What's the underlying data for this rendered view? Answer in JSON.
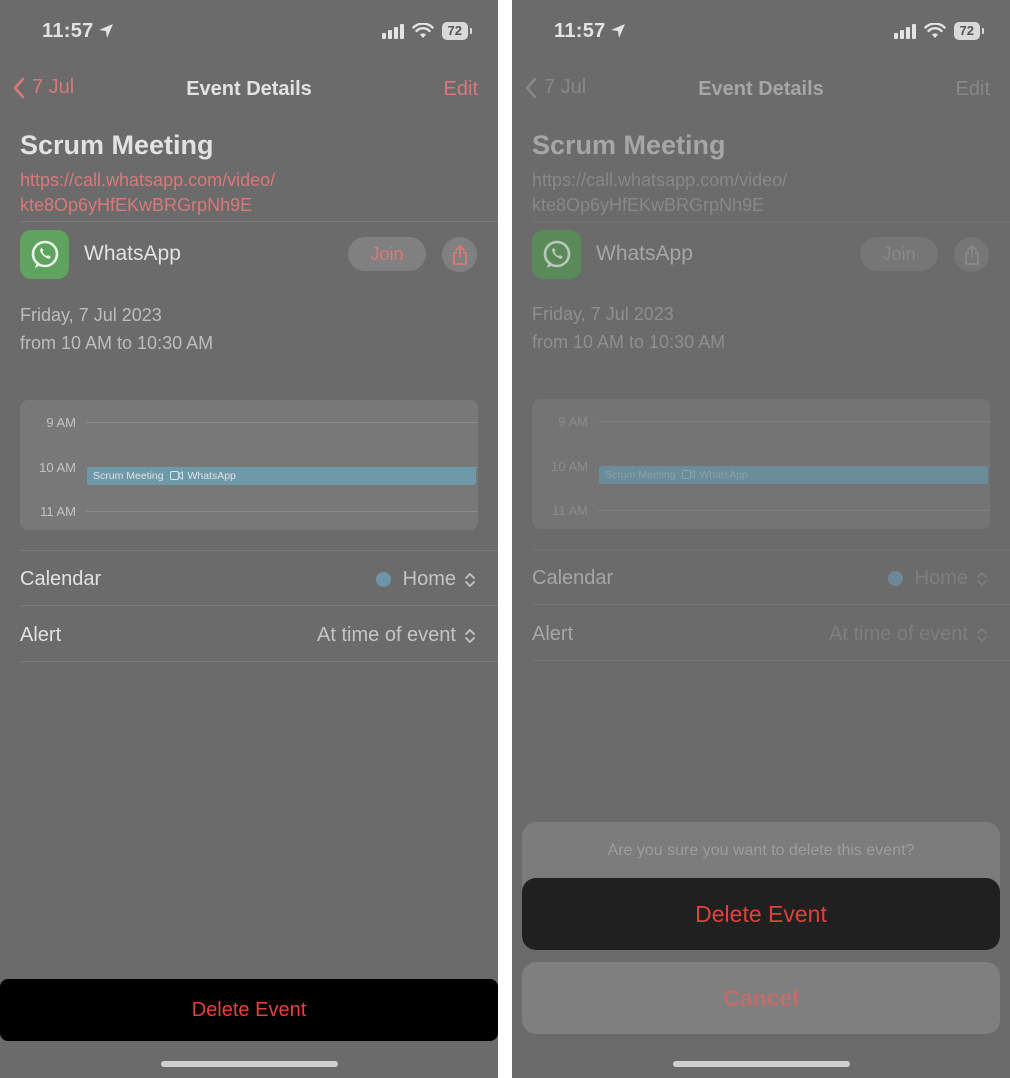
{
  "status": {
    "time": "11:57",
    "battery": "72"
  },
  "nav": {
    "back_label": "7 Jul",
    "title": "Event Details",
    "edit_label": "Edit"
  },
  "event": {
    "title": "Scrum Meeting",
    "link_line1": "https://call.whatsapp.com/video/",
    "link_line2": "kte8Op6yHfEKwBRGrpNh9E",
    "app_name": "WhatsApp",
    "join_label": "Join",
    "date": "Friday, 7 Jul 2023",
    "time_range": "from 10 AM to 10:30 AM"
  },
  "day_view": {
    "hours": [
      "9 AM",
      "10 AM",
      "11 AM"
    ],
    "block_label": "Scrum Meeting",
    "block_app": "WhatsApp"
  },
  "details": {
    "calendar_label": "Calendar",
    "calendar_value": "Home",
    "alert_label": "Alert",
    "alert_value": "At time of event"
  },
  "actions": {
    "delete_label": "Delete Event"
  },
  "confirm_sheet": {
    "message": "Are you sure you want to delete this event?",
    "delete_label": "Delete Event",
    "cancel_label": "Cancel"
  },
  "colors": {
    "accent": "#e6403a",
    "overlay": "#6b6b6b",
    "calendar_dot": "#6e94aa"
  },
  "icons": [
    "location-arrow-icon",
    "signal-icon",
    "wifi-icon",
    "battery-icon",
    "chevron-left-icon",
    "whatsapp-icon",
    "share-icon",
    "video-icon",
    "up-down-chevron-icon"
  ]
}
